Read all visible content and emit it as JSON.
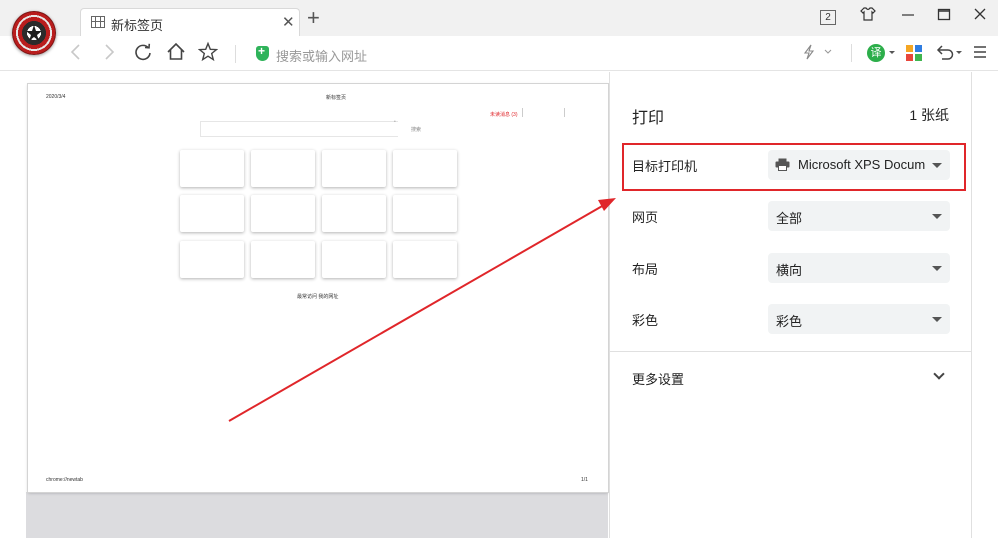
{
  "browser": {
    "tab_title": "新标签页",
    "tab_close": "✕",
    "new_tab": "+",
    "window_badge": "2",
    "address_placeholder": "搜索或输入网址",
    "translate_label": "译"
  },
  "preview": {
    "date": "2020/3/4",
    "page_title": "新标签页",
    "search_label": "搜索",
    "top_right_text": "未读消息 (3)",
    "bottom_links": "最常访问  我的网址",
    "footer_url": "chrome://newtab",
    "footer_page": "1/1"
  },
  "print_panel": {
    "title": "打印",
    "sheet_count": "1 张纸",
    "rows": [
      {
        "label": "目标打印机",
        "value": "Microsoft XPS Docum"
      },
      {
        "label": "网页",
        "value": "全部"
      },
      {
        "label": "布局",
        "value": "横向"
      },
      {
        "label": "彩色",
        "value": "彩色"
      }
    ],
    "more_settings": "更多设置"
  },
  "colors": {
    "highlight": "#e0262a",
    "accent_green": "#2cae4a"
  }
}
